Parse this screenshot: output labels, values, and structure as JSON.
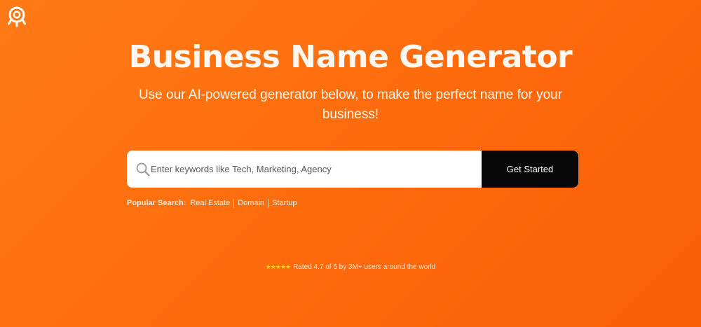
{
  "brand": {
    "logo_icon": "lightbulb-logo-icon"
  },
  "hero": {
    "title": "Business Name Generator",
    "subtitle": "Use our AI-powered generator below, to make the perfect name for your business!"
  },
  "search": {
    "icon": "search-icon",
    "value": "",
    "placeholder": "Enter keywords like Tech, Marketing, Agency",
    "button_label": "Get Started"
  },
  "popular_search": {
    "label": "Popular Search:",
    "items": [
      "Real Estate",
      "Domain",
      "Startup"
    ]
  },
  "rating": {
    "stars": "★★★★★",
    "star_count": 5,
    "text": "Rated 4.7 of 5 by 3M+ users around the world"
  },
  "colors": {
    "background": "#fd6a0c",
    "button": "#070707",
    "stars": "#ffd21a",
    "text": "#ffffff"
  }
}
